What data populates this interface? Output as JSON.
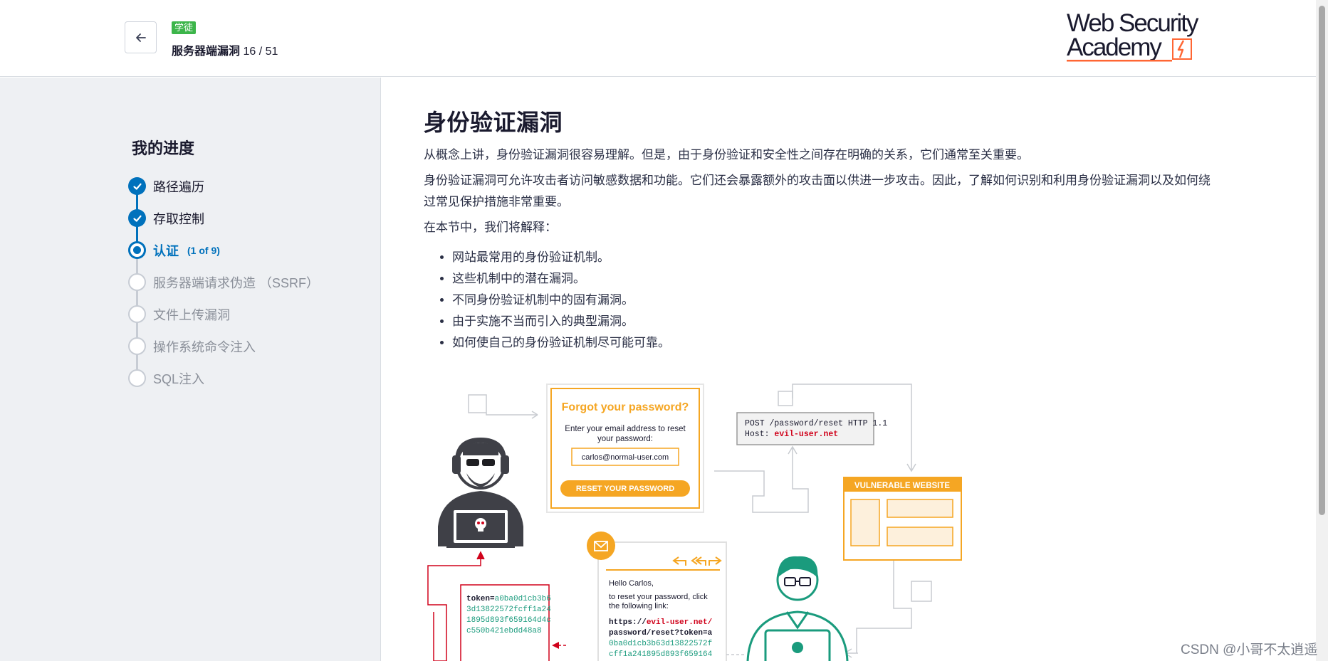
{
  "header": {
    "badge": "学徒",
    "course": "服务器端漏洞",
    "page_count": "16 / 51",
    "logo_line1": "Web Security",
    "logo_line2": "Academy"
  },
  "sidebar": {
    "title": "我的进度",
    "steps": [
      {
        "label": "路径遍历",
        "state": "done"
      },
      {
        "label": "存取控制",
        "state": "done"
      },
      {
        "label": "认证",
        "state": "current",
        "sub": "(1 of 9)"
      },
      {
        "label": "服务器端请求伪造 （SSRF）",
        "state": "todo"
      },
      {
        "label": "文件上传漏洞",
        "state": "todo"
      },
      {
        "label": "操作系统命令注入",
        "state": "todo"
      },
      {
        "label": "SQL注入",
        "state": "todo"
      }
    ]
  },
  "main": {
    "title": "身份验证漏洞",
    "paragraph1": "从概念上讲，身份验证漏洞很容易理解。但是，由于身份验证和安全性之间存在明确的关系，它们通常至关重要。",
    "paragraph2": "身份验证漏洞可允许攻击者访问敏感数据和功能。它们还会暴露额外的攻击面以供进一步攻击。因此，了解如何识别和利用身份验证漏洞以及如何绕过常见保护措施非常重要。",
    "paragraph3": "在本节中，我们将解释：",
    "bullets": [
      "网站最常用的身份验证机制。",
      "这些机制中的潜在漏洞。",
      "不同身份验证机制中的固有漏洞。",
      "由于实施不当而引入的典型漏洞。",
      "如何使自己的身份验证机制尽可能可靠。"
    ]
  },
  "illustration": {
    "forgot_title": "Forgot your password?",
    "forgot_text1": "Enter your email address to reset",
    "forgot_text2": "your password:",
    "email_value": "carlos@normal-user.com",
    "reset_button": "RESET YOUR PASSWORD",
    "http_line1": "POST /password/reset HTTP 1.1",
    "http_host_label": "Host: ",
    "http_host_value": "evil-user.net",
    "vulnerable_label": "VULNERABLE WEBSITE",
    "email_greeting": "Hello Carlos,",
    "email_body1": "to reset your password, click",
    "email_body2": "the following link:",
    "link_prefix": "https://",
    "link_domain": "evil-user.net/",
    "link_line2": "password/reset?token=a",
    "link_line3": "0ba0d1cb3b63d13822572f",
    "link_line4": "cff1a241895d893f659164",
    "token_label": "token=",
    "token_line1": "a0ba0d1cb3b6",
    "token_line2": "3d13822572fcff1a24",
    "token_line3": "1895d893f659164d4c",
    "token_line4": "c550b421ebdd48a8"
  },
  "watermark": "CSDN @小哥不太逍遥",
  "colors": {
    "accent": "#0071bc",
    "badge": "#3cb54a",
    "orange": "#f5a623",
    "red": "#d0021b",
    "teal": "#1a9b7d"
  }
}
